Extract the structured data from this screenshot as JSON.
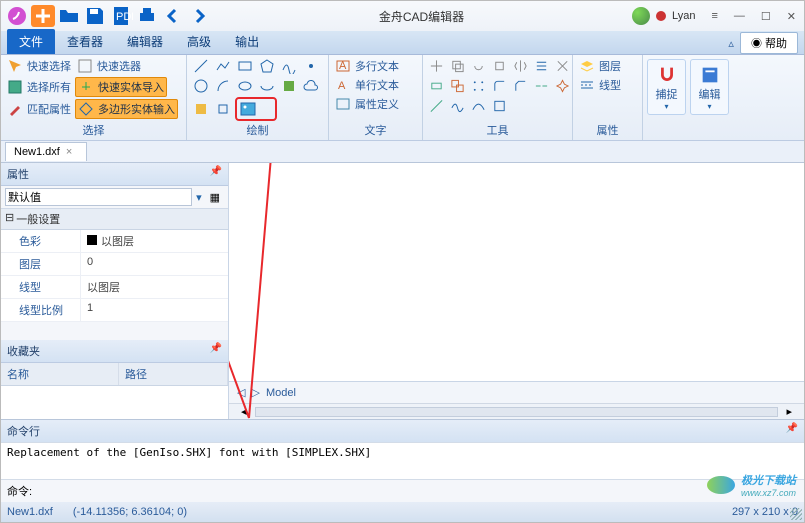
{
  "titlebar": {
    "title": "金舟CAD编辑器",
    "user_name": "Lyan"
  },
  "menu": {
    "tabs": [
      "文件",
      "查看器",
      "编辑器",
      "高级",
      "输出"
    ],
    "active_index": 0,
    "help": "帮助"
  },
  "ribbon": {
    "groups": {
      "select": {
        "label": "选择",
        "btn_quick_select": "快速选择",
        "btn_quick_filter": "快速选器",
        "btn_select_all": "选择所有",
        "btn_quick_import": "快速实体导入",
        "btn_match_prop": "匹配属性",
        "btn_poly_input": "多边形实体输入"
      },
      "draw": {
        "label": "绘制"
      },
      "text": {
        "label": "文字",
        "btn_mtext": "多行文本",
        "btn_text": "单行文本",
        "btn_attdef": "属性定义"
      },
      "tools": {
        "label": "工具"
      },
      "props": {
        "label": "属性",
        "btn_layer": "图层",
        "btn_linetype": "线型"
      },
      "edit": {
        "btn_snap": "捕捉",
        "btn_edit": "编辑"
      }
    }
  },
  "doctab": {
    "name": "New1.dxf"
  },
  "panels": {
    "properties": {
      "title": "属性",
      "default": "默认值",
      "section_general": "一般设置",
      "rows": {
        "color_k": "色彩",
        "color_v": "以图层",
        "layer_k": "图层",
        "layer_v": "0",
        "linetype_k": "线型",
        "linetype_v": "以图层",
        "ltscale_k": "线型比例",
        "ltscale_v": "1"
      }
    },
    "favorites": {
      "title": "收藏夹",
      "col_name": "名称",
      "col_path": "路径"
    }
  },
  "model_tab": "Model",
  "command": {
    "title": "命令行",
    "log": "Replacement of the [GenIso.SHX] font with [SIMPLEX.SHX]",
    "prompt": "命令:"
  },
  "status": {
    "file": "New1.dxf",
    "coords": "(-14.11356; 6.36104; 0)",
    "dims": "297 x 210 x 0"
  },
  "watermark": {
    "text": "极光下载站",
    "url": "www.xz7.com"
  }
}
